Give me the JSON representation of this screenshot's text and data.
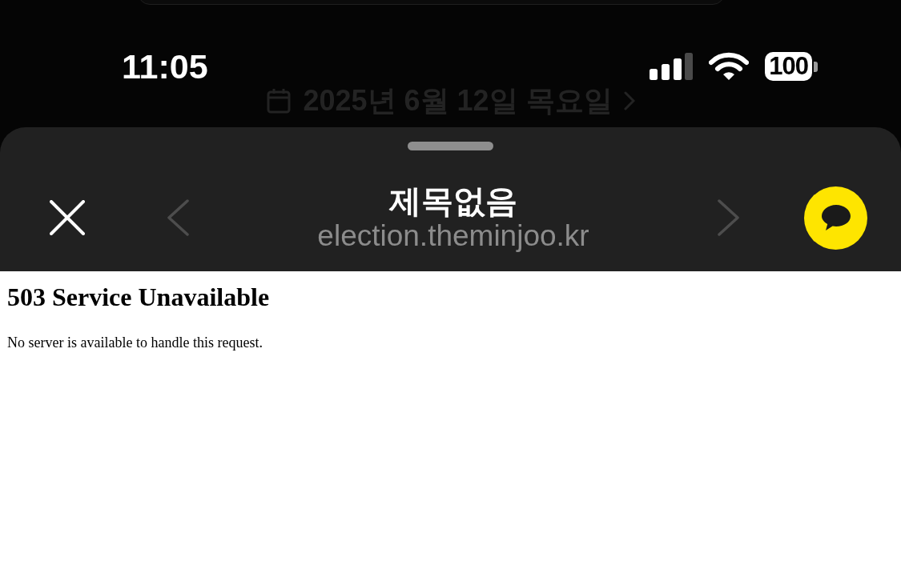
{
  "status_bar": {
    "time": "11:05",
    "battery": "100"
  },
  "background": {
    "date_link": "2025년 6월 12일 목요일"
  },
  "browser_header": {
    "title": "제목없음",
    "url": "election.theminjoo.kr",
    "back": {
      "disabled": true
    },
    "forward": {
      "disabled": true
    }
  },
  "page": {
    "heading": "503 Service Unavailable",
    "message": "No server is available to handle this request."
  }
}
